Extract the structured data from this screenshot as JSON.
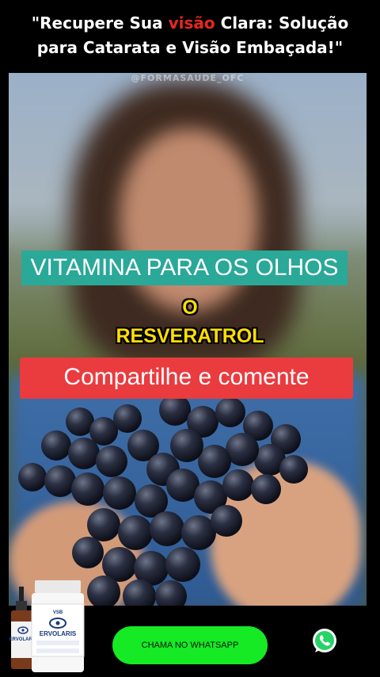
{
  "headline": {
    "quote_open": "\"",
    "part1": "Recupere Sua ",
    "highlight": "visão",
    "part2": " Clara: Solução",
    "line2": "para Catarata e Visão Embaçada!\"",
    "highlight_color": "#e8261f"
  },
  "video": {
    "watermark": "@FORMASAUDE_OFC",
    "title_banner": "VITAMINA PARA OS OLHOS",
    "subtitle": "O RESVERATROL",
    "cta_banner": "Compartilhe e comente"
  },
  "product": {
    "bottle_brand": "VSB",
    "bottle_name": "ERVOLARIS",
    "dropper_name": "ERVOLARIS"
  },
  "footer": {
    "whatsapp_button_label": "CHAMA NO WHATSAPP",
    "whatsapp_icon": "whatsapp-icon",
    "button_color": "#16ea24"
  }
}
